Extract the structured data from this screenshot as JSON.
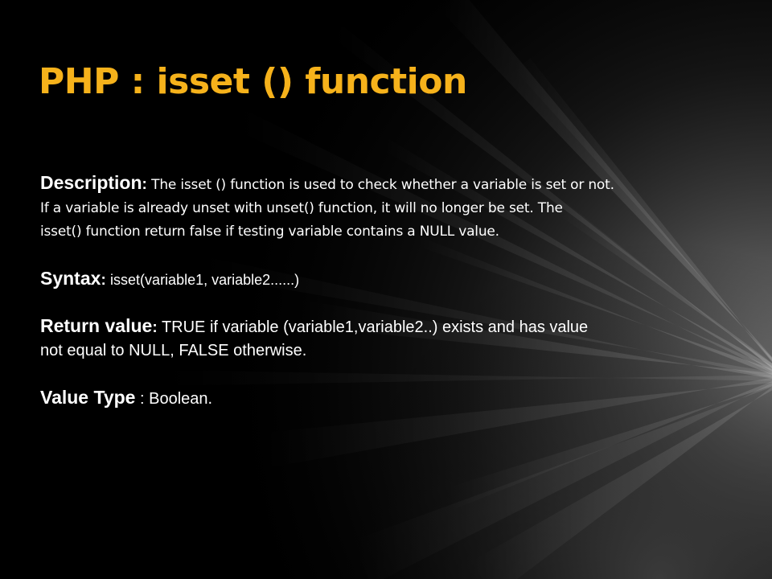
{
  "slide": {
    "title": "PHP : isset () function",
    "title_color": "#f6b21b",
    "background": "#000000",
    "sections": {
      "description": {
        "label": "Description",
        "separator": ": ",
        "lines": [
          "The isset () function is used to check whether a variable is set or not.",
          "If a variable is already unset with unset() function, it will no longer be set. The",
          "isset() function return false if testing variable contains a NULL value."
        ]
      },
      "syntax": {
        "label": "Syntax",
        "separator": ": ",
        "text": "isset(variable1, variable2......)"
      },
      "return_value": {
        "label": "Return value",
        "separator": ": ",
        "lines": [
          "TRUE if variable (variable1,variable2..) exists and has value",
          "not equal to NULL, FALSE otherwise."
        ]
      },
      "value_type": {
        "label": "Value Type",
        "separator": " : ",
        "text": "Boolean."
      }
    }
  }
}
